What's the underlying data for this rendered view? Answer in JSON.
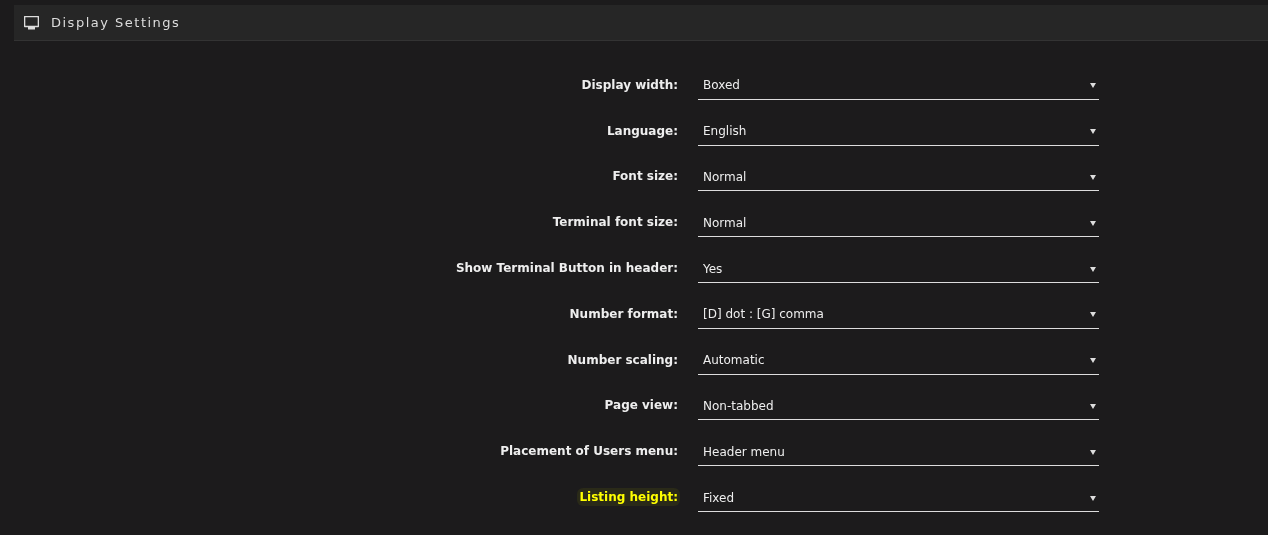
{
  "panel": {
    "title": "Display Settings"
  },
  "settings": [
    {
      "label": "Display width:",
      "value": "Boxed",
      "highlighted": false
    },
    {
      "label": "Language:",
      "value": "English",
      "highlighted": false
    },
    {
      "label": "Font size:",
      "value": "Normal",
      "highlighted": false
    },
    {
      "label": "Terminal font size:",
      "value": "Normal",
      "highlighted": false
    },
    {
      "label": "Show Terminal Button in header:",
      "value": "Yes",
      "highlighted": false
    },
    {
      "label": "Number format:",
      "value": "[D] dot : [G] comma",
      "highlighted": false
    },
    {
      "label": "Number scaling:",
      "value": "Automatic",
      "highlighted": false
    },
    {
      "label": "Page view:",
      "value": "Non-tabbed",
      "highlighted": false
    },
    {
      "label": "Placement of Users menu:",
      "value": "Header menu",
      "highlighted": false
    },
    {
      "label": "Listing height:",
      "value": "Fixed",
      "highlighted": true
    }
  ]
}
